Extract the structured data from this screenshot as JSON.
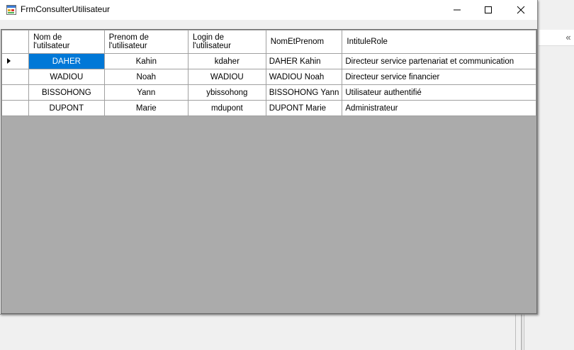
{
  "window": {
    "title": "FrmConsulterUtilisateur"
  },
  "background": {
    "chevron": "«"
  },
  "grid": {
    "columns": [
      {
        "key": "nom",
        "label_line1": "Nom de",
        "label_line2": "l'utilsateur"
      },
      {
        "key": "prenom",
        "label_line1": "Prenom de",
        "label_line2": "l'utilisateur"
      },
      {
        "key": "login",
        "label_line1": "Login de",
        "label_line2": "l'utilisateur"
      },
      {
        "key": "nomEtPrenom",
        "label_line1": "NomEtPrenom",
        "label_line2": ""
      },
      {
        "key": "intituleRole",
        "label_line1": "IntituleRole",
        "label_line2": ""
      }
    ],
    "rows": [
      {
        "nom": "DAHER",
        "prenom": "Kahin",
        "login": "kdaher",
        "nomEtPrenom": "DAHER Kahin",
        "intituleRole": "Directeur service partenariat et communication"
      },
      {
        "nom": "WADIOU",
        "prenom": "Noah",
        "login": "WADIOU",
        "nomEtPrenom": "WADIOU Noah",
        "intituleRole": "Directeur service financier"
      },
      {
        "nom": "BISSOHONG",
        "prenom": "Yann",
        "login": "ybissohong",
        "nomEtPrenom": "BISSOHONG Yann",
        "intituleRole": "Utilisateur authentifié"
      },
      {
        "nom": "DUPONT",
        "prenom": "Marie",
        "login": "mdupont",
        "nomEtPrenom": "DUPONT Marie",
        "intituleRole": "Administrateur"
      }
    ],
    "selected_row": 0
  },
  "colors": {
    "selection": "#0078d7",
    "grid_background": "#ababab"
  },
  "icons": {
    "app": "app-form-icon",
    "minimize": "minimize-icon",
    "maximize": "maximize-icon",
    "close": "close-icon",
    "current_row": "row-indicator-arrow-icon"
  }
}
